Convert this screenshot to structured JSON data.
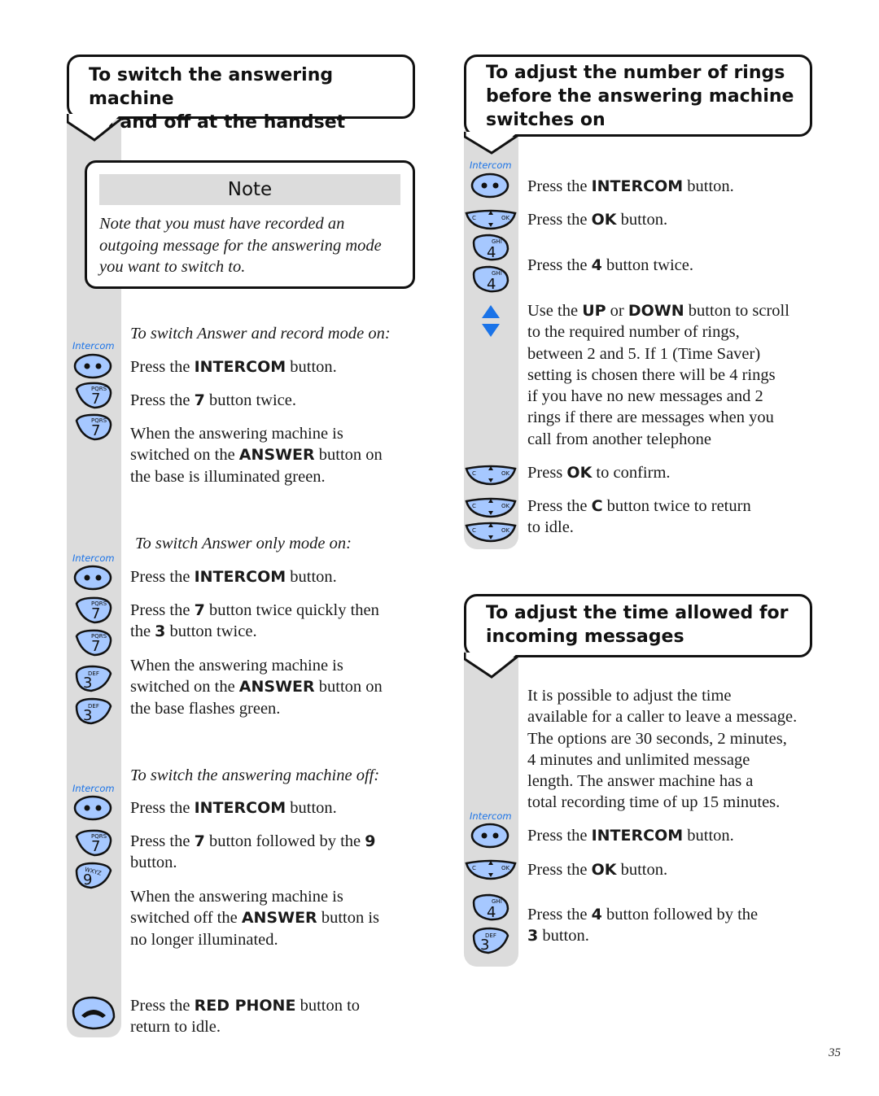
{
  "page_number": "35",
  "colors": {
    "key_fill": "#a6c8ff",
    "rail_gray": "#dcdcdc",
    "intercom_label": "#1a73e8",
    "arrow_blue": "#1a73e8"
  },
  "left": {
    "heading": [
      "To switch the answering machine",
      "on and off at the handset"
    ],
    "note": {
      "title": "Note",
      "lines": [
        "Note that you must have recorded an",
        "outgoing message for the answering mode",
        "you want to switch to."
      ]
    },
    "sections": [
      {
        "subtitle": "To switch Answer and record mode on:",
        "intercom_label": "Intercom",
        "keys": [
          "intercom-key",
          "7-key",
          "7-key"
        ],
        "steps": [
          {
            "pre": "Press the ",
            "bold": "INTERCOM",
            "post": " button."
          },
          {
            "pre": "Press the ",
            "bold": "7",
            "post": " button twice."
          },
          {
            "l1": "When the answering machine is",
            "l2pre": "switched on the ",
            "bold": "ANSWER",
            "l2post": " button on",
            "l3": "the base is illuminated green."
          }
        ]
      },
      {
        "subtitle": "To switch Answer only mode on:",
        "intercom_label": "Intercom",
        "keys": [
          "intercom-key",
          "7-key",
          "7-key",
          "3-key",
          "3-key"
        ],
        "steps": [
          {
            "pre": "Press the ",
            "bold": "INTERCOM",
            "post": " button."
          },
          {
            "pre": "Press the ",
            "bold": "7",
            "post": " button twice quickly then",
            "l2pre": "the ",
            "bold2": "3",
            "l2post": " button twice."
          },
          {
            "l1": "When the answering machine is",
            "l2pre": "switched on the ",
            "bold": "ANSWER",
            "l2post": " button on",
            "l3": "the base flashes green."
          }
        ]
      },
      {
        "subtitle": "To switch the answering machine off:",
        "intercom_label": "Intercom",
        "keys": [
          "intercom-key",
          "7-key",
          "9-key"
        ],
        "steps": [
          {
            "pre": "Press the ",
            "bold": "INTERCOM",
            "post": " button."
          },
          {
            "pre": "Press the ",
            "bold": "7",
            "post": " button followed by the ",
            "bold2": "9",
            "l2": "button."
          },
          {
            "l1": "When the answering machine is",
            "l2pre": "switched off the ",
            "bold": "ANSWER",
            "l2post": " button is",
            "l3": "no longer  illuminated."
          }
        ]
      }
    ],
    "final_step": {
      "pre": "Press the ",
      "bold": "RED PHONE",
      "post": " button to",
      "l2": "return to idle."
    }
  },
  "right": {
    "rings": {
      "heading": [
        "To adjust the number of rings",
        "before the answering machine",
        "switches on"
      ],
      "intercom_label": "Intercom",
      "steps": [
        {
          "pre": "Press the ",
          "bold": "INTERCOM",
          "post": " button."
        },
        {
          "pre": "Press the ",
          "bold": "OK",
          "post": " button."
        },
        {
          "pre": "Press the ",
          "bold": "4",
          "post": " button twice."
        },
        {
          "pre": "Use the ",
          "bold": "UP",
          "mid": " or ",
          "bold2": "DOWN",
          "post": " button to scroll",
          "more": [
            "to the required number of rings,",
            "between 2 and 5. If 1 (Time Saver)",
            "setting is chosen there will be 4 rings",
            "if you have no new messages and 2",
            "rings if there are messages when you",
            "call from another telephone"
          ]
        },
        {
          "pre": "Press ",
          "bold": "OK",
          "post": " to confirm."
        },
        {
          "pre": "Press the ",
          "bold": "C",
          "post": " button twice to return",
          "l2": "to idle."
        }
      ]
    },
    "time": {
      "heading": [
        "To adjust the time allowed for",
        "incoming messages"
      ],
      "intro": [
        "It is possible to adjust the time",
        "available for a caller to leave a message.",
        "The options are 30 seconds, 2 minutes,",
        "4 minutes and unlimited message",
        "length. The answer machine has a",
        "total recording time of up 15 minutes."
      ],
      "intercom_label": "Intercom",
      "steps": [
        {
          "pre": "Press the ",
          "bold": "INTERCOM",
          "post": " button."
        },
        {
          "pre": "Press the ",
          "bold": "OK",
          "post": " button."
        },
        {
          "pre": "Press the ",
          "bold": "4",
          "post": " button followed by the",
          "l2bold": "3",
          "l2post": " button."
        }
      ]
    }
  },
  "key_glyphs": {
    "7": {
      "digit": "7",
      "letters": "PQRS"
    },
    "3": {
      "digit": "3",
      "letters": "DEF"
    },
    "9": {
      "digit": "9",
      "letters": "WXYZ"
    },
    "4": {
      "digit": "4",
      "letters": "GHI"
    },
    "nav": {
      "left": "C",
      "right": "OK"
    }
  }
}
